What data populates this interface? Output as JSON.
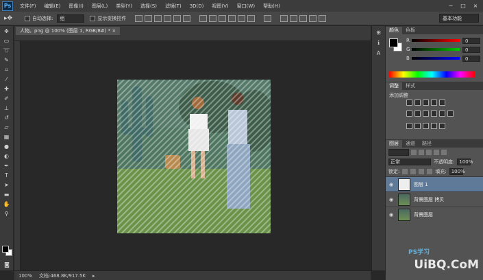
{
  "app": {
    "logo": "Ps"
  },
  "menu": [
    "文件(F)",
    "编辑(E)",
    "图像(I)",
    "图层(L)",
    "类型(Y)",
    "选择(S)",
    "滤镜(T)",
    "3D(D)",
    "视图(V)",
    "窗口(W)",
    "帮助(H)"
  ],
  "window_controls": [
    "−",
    "□",
    "×"
  ],
  "options": {
    "auto_select_label": "自动选择:",
    "auto_select_value": "组",
    "show_transform_label": "显示变换控件",
    "workspace": "基本功能"
  },
  "document": {
    "tab_title": "人物。png @ 100% (图层 1, RGB/8#) * ×",
    "zoom": "100%",
    "doc_info": "文档:468.8K/917.5K"
  },
  "color_panel": {
    "tabs": [
      "颜色",
      "色板"
    ],
    "labels": [
      "R",
      "G",
      "B"
    ],
    "values": [
      "0",
      "0",
      "0"
    ]
  },
  "adjust_panel": {
    "tabs": [
      "调整",
      "样式"
    ],
    "title": "添加调整"
  },
  "layers_panel": {
    "tabs": [
      "图层",
      "通道",
      "路径"
    ],
    "blend_mode": "正常",
    "opacity_label": "不透明度:",
    "opacity": "100%",
    "lock_label": "锁定:",
    "fill_label": "填充:",
    "fill": "100%",
    "layers": [
      {
        "name": "图层 1",
        "selected": true
      },
      {
        "name": "背景图层 拷贝",
        "selected": false
      },
      {
        "name": "背景图层",
        "selected": false
      }
    ]
  },
  "watermark": {
    "text": "UiBQ.CoM",
    "sub": "PS学习"
  },
  "colors": {
    "accent": "#5fb3f4",
    "selection": "#5e7a98"
  }
}
